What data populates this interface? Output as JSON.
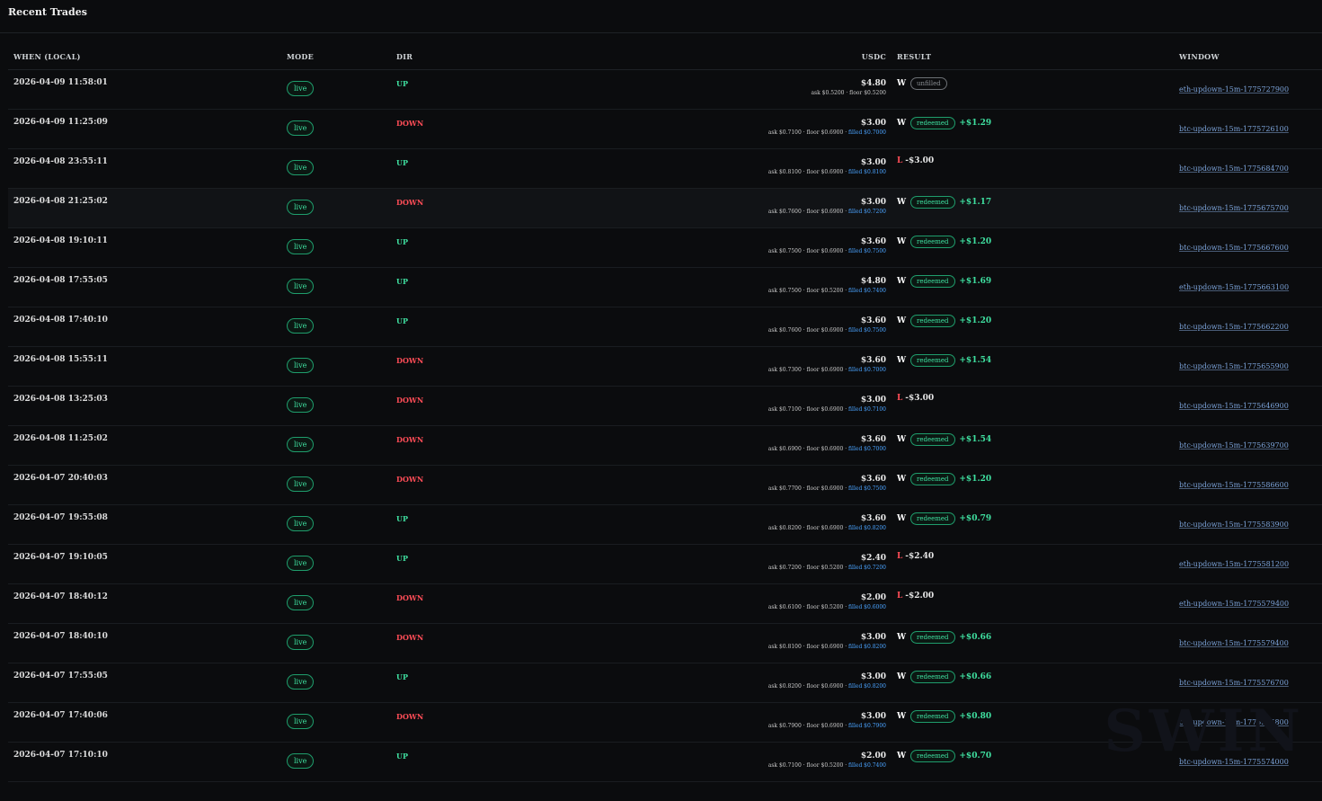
{
  "panel": {
    "title": "Recent Trades"
  },
  "columns": {
    "when": "WHEN (LOCAL)",
    "mode": "MODE",
    "dir": "DIR",
    "usdc": "USDC",
    "result": "RESULT",
    "window": "WINDOW"
  },
  "rows": [
    {
      "when": "2026-04-09 11:58:01",
      "mode": "live",
      "dir": "UP",
      "usdc": "$4.80",
      "ask": "ask $0.5200 · floor $0.5200",
      "filled": "",
      "outcome": "W",
      "status": "unfilled",
      "pnl": "",
      "window": "eth-updown-15m-1775727900"
    },
    {
      "when": "2026-04-09 11:25:09",
      "mode": "live",
      "dir": "DOWN",
      "usdc": "$3.00",
      "ask": "ask $0.7100 · floor $0.6900 · ",
      "filled": "filled $0.7000",
      "outcome": "W",
      "status": "redeemed",
      "pnl": "+$1.29",
      "window": "btc-updown-15m-1775726100"
    },
    {
      "when": "2026-04-08 23:55:11",
      "mode": "live",
      "dir": "UP",
      "usdc": "$3.00",
      "ask": "ask $0.8100 · floor $0.6900 · ",
      "filled": "filled $0.8100",
      "outcome": "L",
      "status": "",
      "pnl": "-$3.00",
      "window": "btc-updown-15m-1775684700"
    },
    {
      "when": "2026-04-08 21:25:02",
      "mode": "live",
      "dir": "DOWN",
      "usdc": "$3.00",
      "ask": "ask $0.7600 · floor $0.6900 · ",
      "filled": "filled $0.7200",
      "outcome": "W",
      "status": "redeemed",
      "pnl": "+$1.17",
      "window": "btc-updown-15m-1775675700"
    },
    {
      "when": "2026-04-08 19:10:11",
      "mode": "live",
      "dir": "UP",
      "usdc": "$3.60",
      "ask": "ask $0.7500 · floor $0.6900 · ",
      "filled": "filled $0.7500",
      "outcome": "W",
      "status": "redeemed",
      "pnl": "+$1.20",
      "window": "btc-updown-15m-1775667600"
    },
    {
      "when": "2026-04-08 17:55:05",
      "mode": "live",
      "dir": "UP",
      "usdc": "$4.80",
      "ask": "ask $0.7500 · floor $0.5200 · ",
      "filled": "filled $0.7400",
      "outcome": "W",
      "status": "redeemed",
      "pnl": "+$1.69",
      "window": "eth-updown-15m-1775663100"
    },
    {
      "when": "2026-04-08 17:40:10",
      "mode": "live",
      "dir": "UP",
      "usdc": "$3.60",
      "ask": "ask $0.7600 · floor $0.6900 · ",
      "filled": "filled $0.7500",
      "outcome": "W",
      "status": "redeemed",
      "pnl": "+$1.20",
      "window": "btc-updown-15m-1775662200"
    },
    {
      "when": "2026-04-08 15:55:11",
      "mode": "live",
      "dir": "DOWN",
      "usdc": "$3.60",
      "ask": "ask $0.7300 · floor $0.6900 · ",
      "filled": "filled $0.7000",
      "outcome": "W",
      "status": "redeemed",
      "pnl": "+$1.54",
      "window": "btc-updown-15m-1775655900"
    },
    {
      "when": "2026-04-08 13:25:03",
      "mode": "live",
      "dir": "DOWN",
      "usdc": "$3.00",
      "ask": "ask $0.7100 · floor $0.6900 · ",
      "filled": "filled $0.7100",
      "outcome": "L",
      "status": "",
      "pnl": "-$3.00",
      "window": "btc-updown-15m-1775646900"
    },
    {
      "when": "2026-04-08 11:25:02",
      "mode": "live",
      "dir": "DOWN",
      "usdc": "$3.60",
      "ask": "ask $0.6900 · floor $0.6900 · ",
      "filled": "filled $0.7000",
      "outcome": "W",
      "status": "redeemed",
      "pnl": "+$1.54",
      "window": "btc-updown-15m-1775639700"
    },
    {
      "when": "2026-04-07 20:40:03",
      "mode": "live",
      "dir": "DOWN",
      "usdc": "$3.60",
      "ask": "ask $0.7700 · floor $0.6900 · ",
      "filled": "filled $0.7500",
      "outcome": "W",
      "status": "redeemed",
      "pnl": "+$1.20",
      "window": "btc-updown-15m-1775586600"
    },
    {
      "when": "2026-04-07 19:55:08",
      "mode": "live",
      "dir": "UP",
      "usdc": "$3.60",
      "ask": "ask $0.8200 · floor $0.6900 · ",
      "filled": "filled $0.8200",
      "outcome": "W",
      "status": "redeemed",
      "pnl": "+$0.79",
      "window": "btc-updown-15m-1775583900"
    },
    {
      "when": "2026-04-07 19:10:05",
      "mode": "live",
      "dir": "UP",
      "usdc": "$2.40",
      "ask": "ask $0.7200 · floor $0.5200 · ",
      "filled": "filled $0.7200",
      "outcome": "L",
      "status": "",
      "pnl": "-$2.40",
      "window": "eth-updown-15m-1775581200"
    },
    {
      "when": "2026-04-07 18:40:12",
      "mode": "live",
      "dir": "DOWN",
      "usdc": "$2.00",
      "ask": "ask $0.6100 · floor $0.5200 · ",
      "filled": "filled $0.6000",
      "outcome": "L",
      "status": "",
      "pnl": "-$2.00",
      "window": "eth-updown-15m-1775579400"
    },
    {
      "when": "2026-04-07 18:40:10",
      "mode": "live",
      "dir": "DOWN",
      "usdc": "$3.00",
      "ask": "ask $0.8100 · floor $0.6900 · ",
      "filled": "filled $0.8200",
      "outcome": "W",
      "status": "redeemed",
      "pnl": "+$0.66",
      "window": "btc-updown-15m-1775579400"
    },
    {
      "when": "2026-04-07 17:55:05",
      "mode": "live",
      "dir": "UP",
      "usdc": "$3.00",
      "ask": "ask $0.8200 · floor $0.6900 · ",
      "filled": "filled $0.8200",
      "outcome": "W",
      "status": "redeemed",
      "pnl": "+$0.66",
      "window": "btc-updown-15m-1775576700"
    },
    {
      "when": "2026-04-07 17:40:06",
      "mode": "live",
      "dir": "DOWN",
      "usdc": "$3.00",
      "ask": "ask $0.7900 · floor $0.6900 · ",
      "filled": "filled $0.7900",
      "outcome": "W",
      "status": "redeemed",
      "pnl": "+$0.80",
      "window": "btc-updown-15m-1775575800"
    },
    {
      "when": "2026-04-07 17:10:10",
      "mode": "live",
      "dir": "UP",
      "usdc": "$2.00",
      "ask": "ask $0.7100 · floor $0.5200 · ",
      "filled": "filled $0.7400",
      "outcome": "W",
      "status": "redeemed",
      "pnl": "+$0.70",
      "window": "btc-updown-15m-1775574000"
    }
  ]
}
